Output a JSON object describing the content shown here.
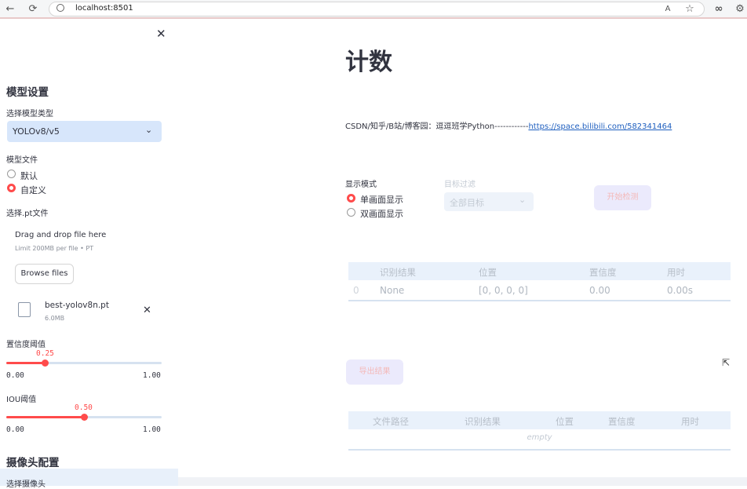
{
  "browser": {
    "url": "localhost:8501"
  },
  "sidebar": {
    "model_settings_title": "模型设置",
    "model_type_label": "选择模型类型",
    "model_type_value": "YOLOv8/v5",
    "model_file_label": "模型文件",
    "model_file_options": [
      "默认",
      "自定义"
    ],
    "model_file_selected": "自定义",
    "pt_label": "选择.pt文件",
    "uploader_drag_text": "Drag and drop file here",
    "uploader_limit_text": "Limit 200MB per file • PT",
    "browse_button": "Browse files",
    "uploaded_file_name": "best-yolov8n.pt",
    "uploaded_file_size": "6.0MB",
    "conf_label": "置信度阈值",
    "conf_value": "0.25",
    "conf_min": "0.00",
    "conf_max": "1.00",
    "conf_fraction": 0.25,
    "iou_label": "IOU阈值",
    "iou_value": "0.50",
    "iou_min": "0.00",
    "iou_max": "1.00",
    "iou_fraction": 0.5,
    "camera_title": "摄像头配置",
    "camera_label": "选择摄像头"
  },
  "main": {
    "title": "计数",
    "info_prefix": "CSDN/知乎/B站/博客园：逗逗班学Python------------",
    "info_link": "https://space.bilibili.com/582341464",
    "display_mode_label": "显示模式",
    "display_mode_options": [
      "单画面显示",
      "双画面显示"
    ],
    "display_mode_selected": "单画面显示",
    "target_filter_label": "目标过滤",
    "target_filter_value": "全部目标",
    "start_button": "开始检测",
    "results_table": {
      "columns": [
        "",
        "识别结果",
        "位置",
        "置信度",
        "用时"
      ],
      "rows": [
        [
          "0",
          "None",
          "[0, 0, 0, 0]",
          "0.00",
          "0.00s"
        ]
      ]
    },
    "export_button": "导出结果",
    "file_table": {
      "columns": [
        "",
        "文件路径",
        "识别结果",
        "位置",
        "置信度",
        "用时"
      ],
      "empty_text": "empty"
    }
  }
}
